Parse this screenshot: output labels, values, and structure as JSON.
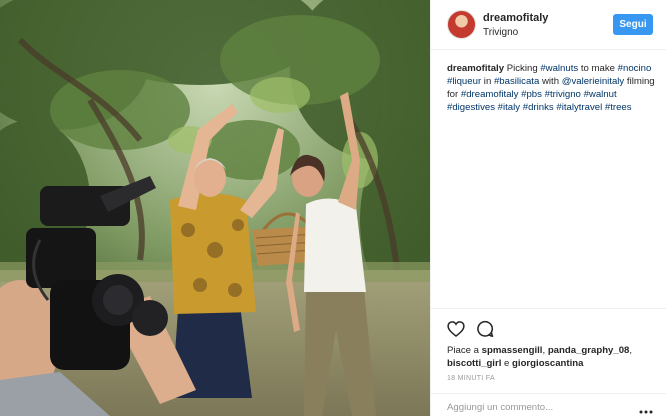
{
  "post": {
    "username": "dreamofitaly",
    "location": "Trivigno",
    "follow_label": "Segui",
    "caption": {
      "author": "dreamofitaly",
      "segments": [
        {
          "text": " Picking ",
          "tag": false
        },
        {
          "text": "#walnuts",
          "tag": true
        },
        {
          "text": " to make ",
          "tag": false
        },
        {
          "text": "#nocino",
          "tag": true
        },
        {
          "text": " ",
          "tag": false
        },
        {
          "text": "#liqueur",
          "tag": true
        },
        {
          "text": " in ",
          "tag": false
        },
        {
          "text": "#basilicata",
          "tag": true
        },
        {
          "text": " with ",
          "tag": false
        },
        {
          "text": "@valerieinitaly",
          "tag": true
        },
        {
          "text": " filming for ",
          "tag": false
        },
        {
          "text": "#dreamofitaly",
          "tag": true
        },
        {
          "text": " ",
          "tag": false
        },
        {
          "text": "#pbs",
          "tag": true
        },
        {
          "text": " ",
          "tag": false
        },
        {
          "text": "#trivigno",
          "tag": true
        },
        {
          "text": " ",
          "tag": false
        },
        {
          "text": "#walnut",
          "tag": true
        },
        {
          "text": " ",
          "tag": false
        },
        {
          "text": "#digestives",
          "tag": true
        },
        {
          "text": " ",
          "tag": false
        },
        {
          "text": "#italy",
          "tag": true
        },
        {
          "text": " ",
          "tag": false
        },
        {
          "text": "#drinks",
          "tag": true
        },
        {
          "text": " ",
          "tag": false
        },
        {
          "text": "#italytravel",
          "tag": true
        },
        {
          "text": " ",
          "tag": false
        },
        {
          "text": "#trees",
          "tag": true
        }
      ]
    },
    "likes": {
      "prefix": "Piace a ",
      "users": [
        "spmassengill",
        "panda_graphy_08",
        "biscotti_girl",
        "giorgioscantina"
      ],
      "conjunction": " e "
    },
    "time": "18 MINUTI FA",
    "comment_placeholder": "Aggiungi un commento...",
    "icons": {
      "like": "heart-icon",
      "comment": "comment-bubble-icon",
      "more": "ellipsis-icon"
    }
  },
  "colors": {
    "follow_button": "#3897f0",
    "hashtag": "#003569",
    "timestamp": "#999999"
  }
}
